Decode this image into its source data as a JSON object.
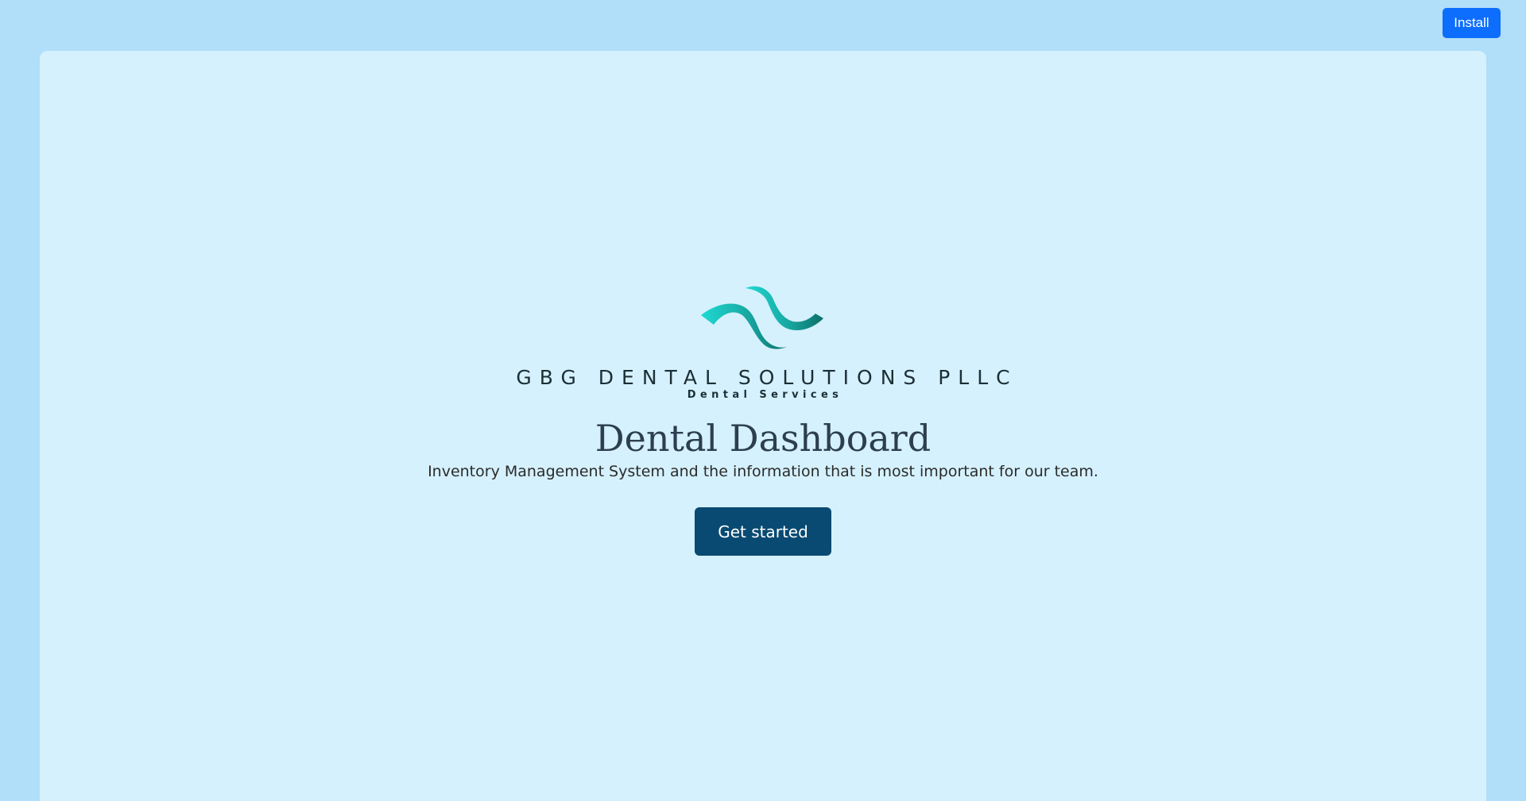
{
  "header": {
    "install_label": "Install"
  },
  "logo": {
    "company_name": "GBG DENTAL SOLUTIONS PLLC",
    "tagline": "Dental Services",
    "mark_icon": "wave-logo-icon",
    "colors": {
      "light_teal": "#1fd6d0",
      "dark_teal": "#0f7a72"
    }
  },
  "hero": {
    "title": "Dental Dashboard",
    "subtitle": "Inventory Management System and the information that is most important for our team.",
    "cta_label": "Get started"
  },
  "colors": {
    "page_background": "#b1def9",
    "card_background": "#d5f1fd",
    "install_button": "#0d6efd",
    "cta_button": "#094a72"
  }
}
